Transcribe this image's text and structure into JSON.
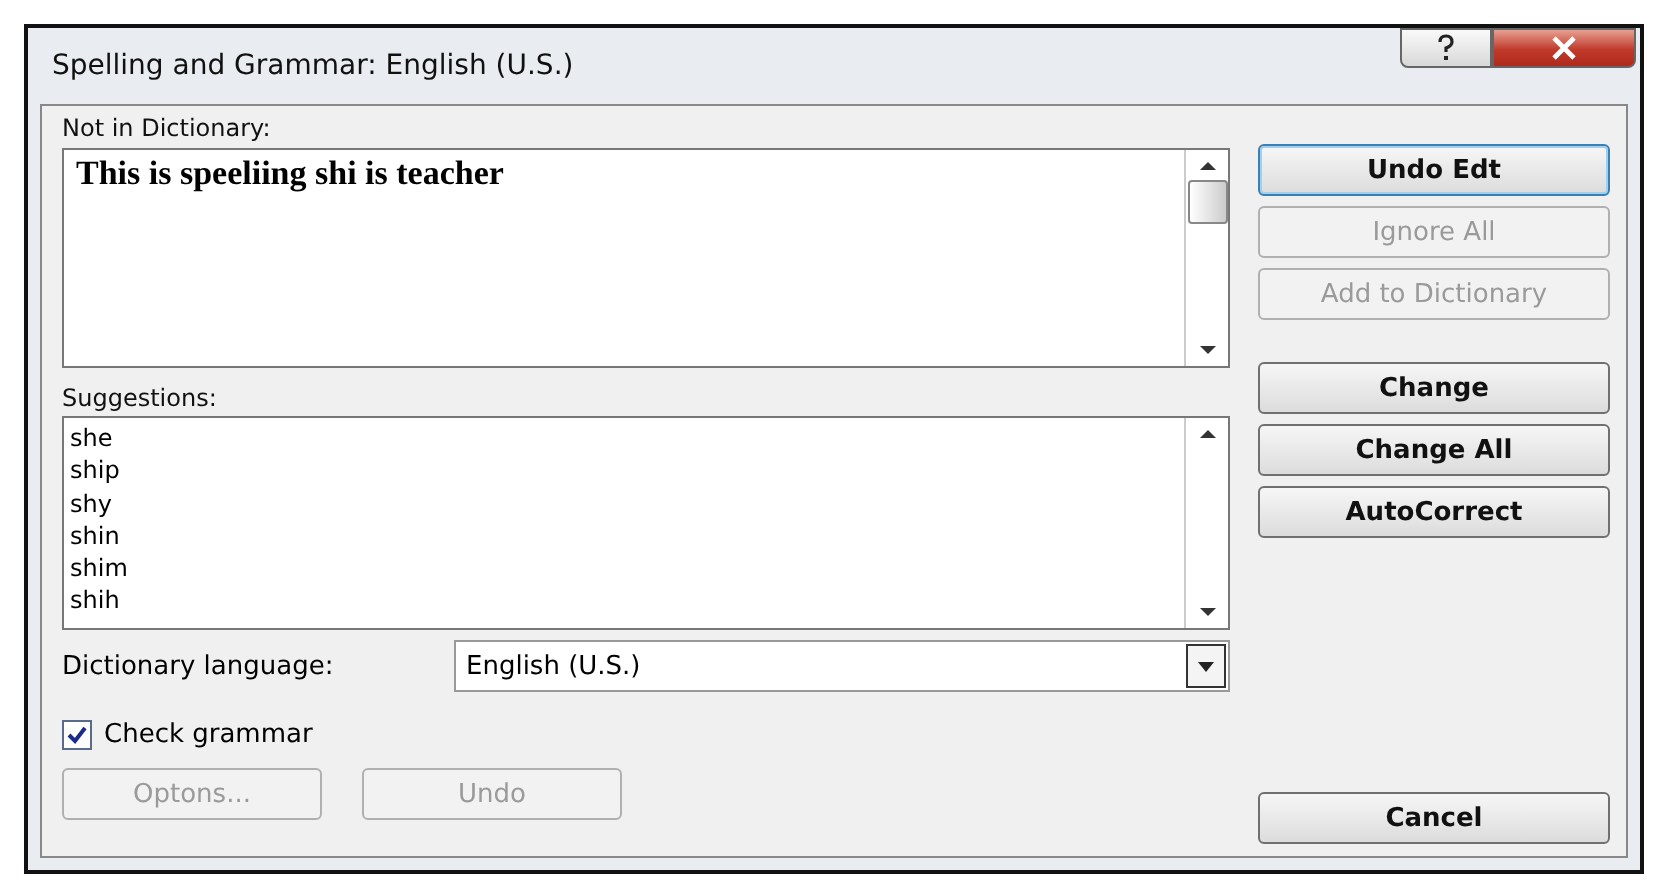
{
  "window": {
    "title": "Spelling and Grammar: English (U.S.)"
  },
  "not_in_dictionary": {
    "label": "Not in Dictionary:",
    "text": "This is speeliing shi is teacher"
  },
  "suggestions": {
    "label": "Suggestions:",
    "items": [
      "she",
      "ship",
      "shy",
      "shin",
      "shim",
      "shih"
    ]
  },
  "dictionary_language": {
    "label": "Dictionary language:",
    "value": "English (U.S.)"
  },
  "check_grammar": {
    "label": "Check grammar",
    "checked": true
  },
  "top_buttons": [
    {
      "label": "Undo Edt",
      "disabled": false,
      "focused": true
    },
    {
      "label": "Ignore All",
      "disabled": true,
      "focused": false
    },
    {
      "label": "Add to Dictionary",
      "disabled": true,
      "focused": false
    }
  ],
  "middle_buttons": [
    {
      "label": "Change",
      "disabled": false,
      "focused": false
    },
    {
      "label": "Change All",
      "disabled": false,
      "focused": false
    },
    {
      "label": "AutoCorrect",
      "disabled": false,
      "focused": false
    }
  ],
  "bottom_left_buttons": [
    {
      "label": "Optons...",
      "disabled": true,
      "focused": false
    },
    {
      "label": "Undo",
      "disabled": true,
      "focused": false
    }
  ],
  "cancel_button": {
    "label": "Cancel",
    "disabled": false,
    "focused": false
  }
}
